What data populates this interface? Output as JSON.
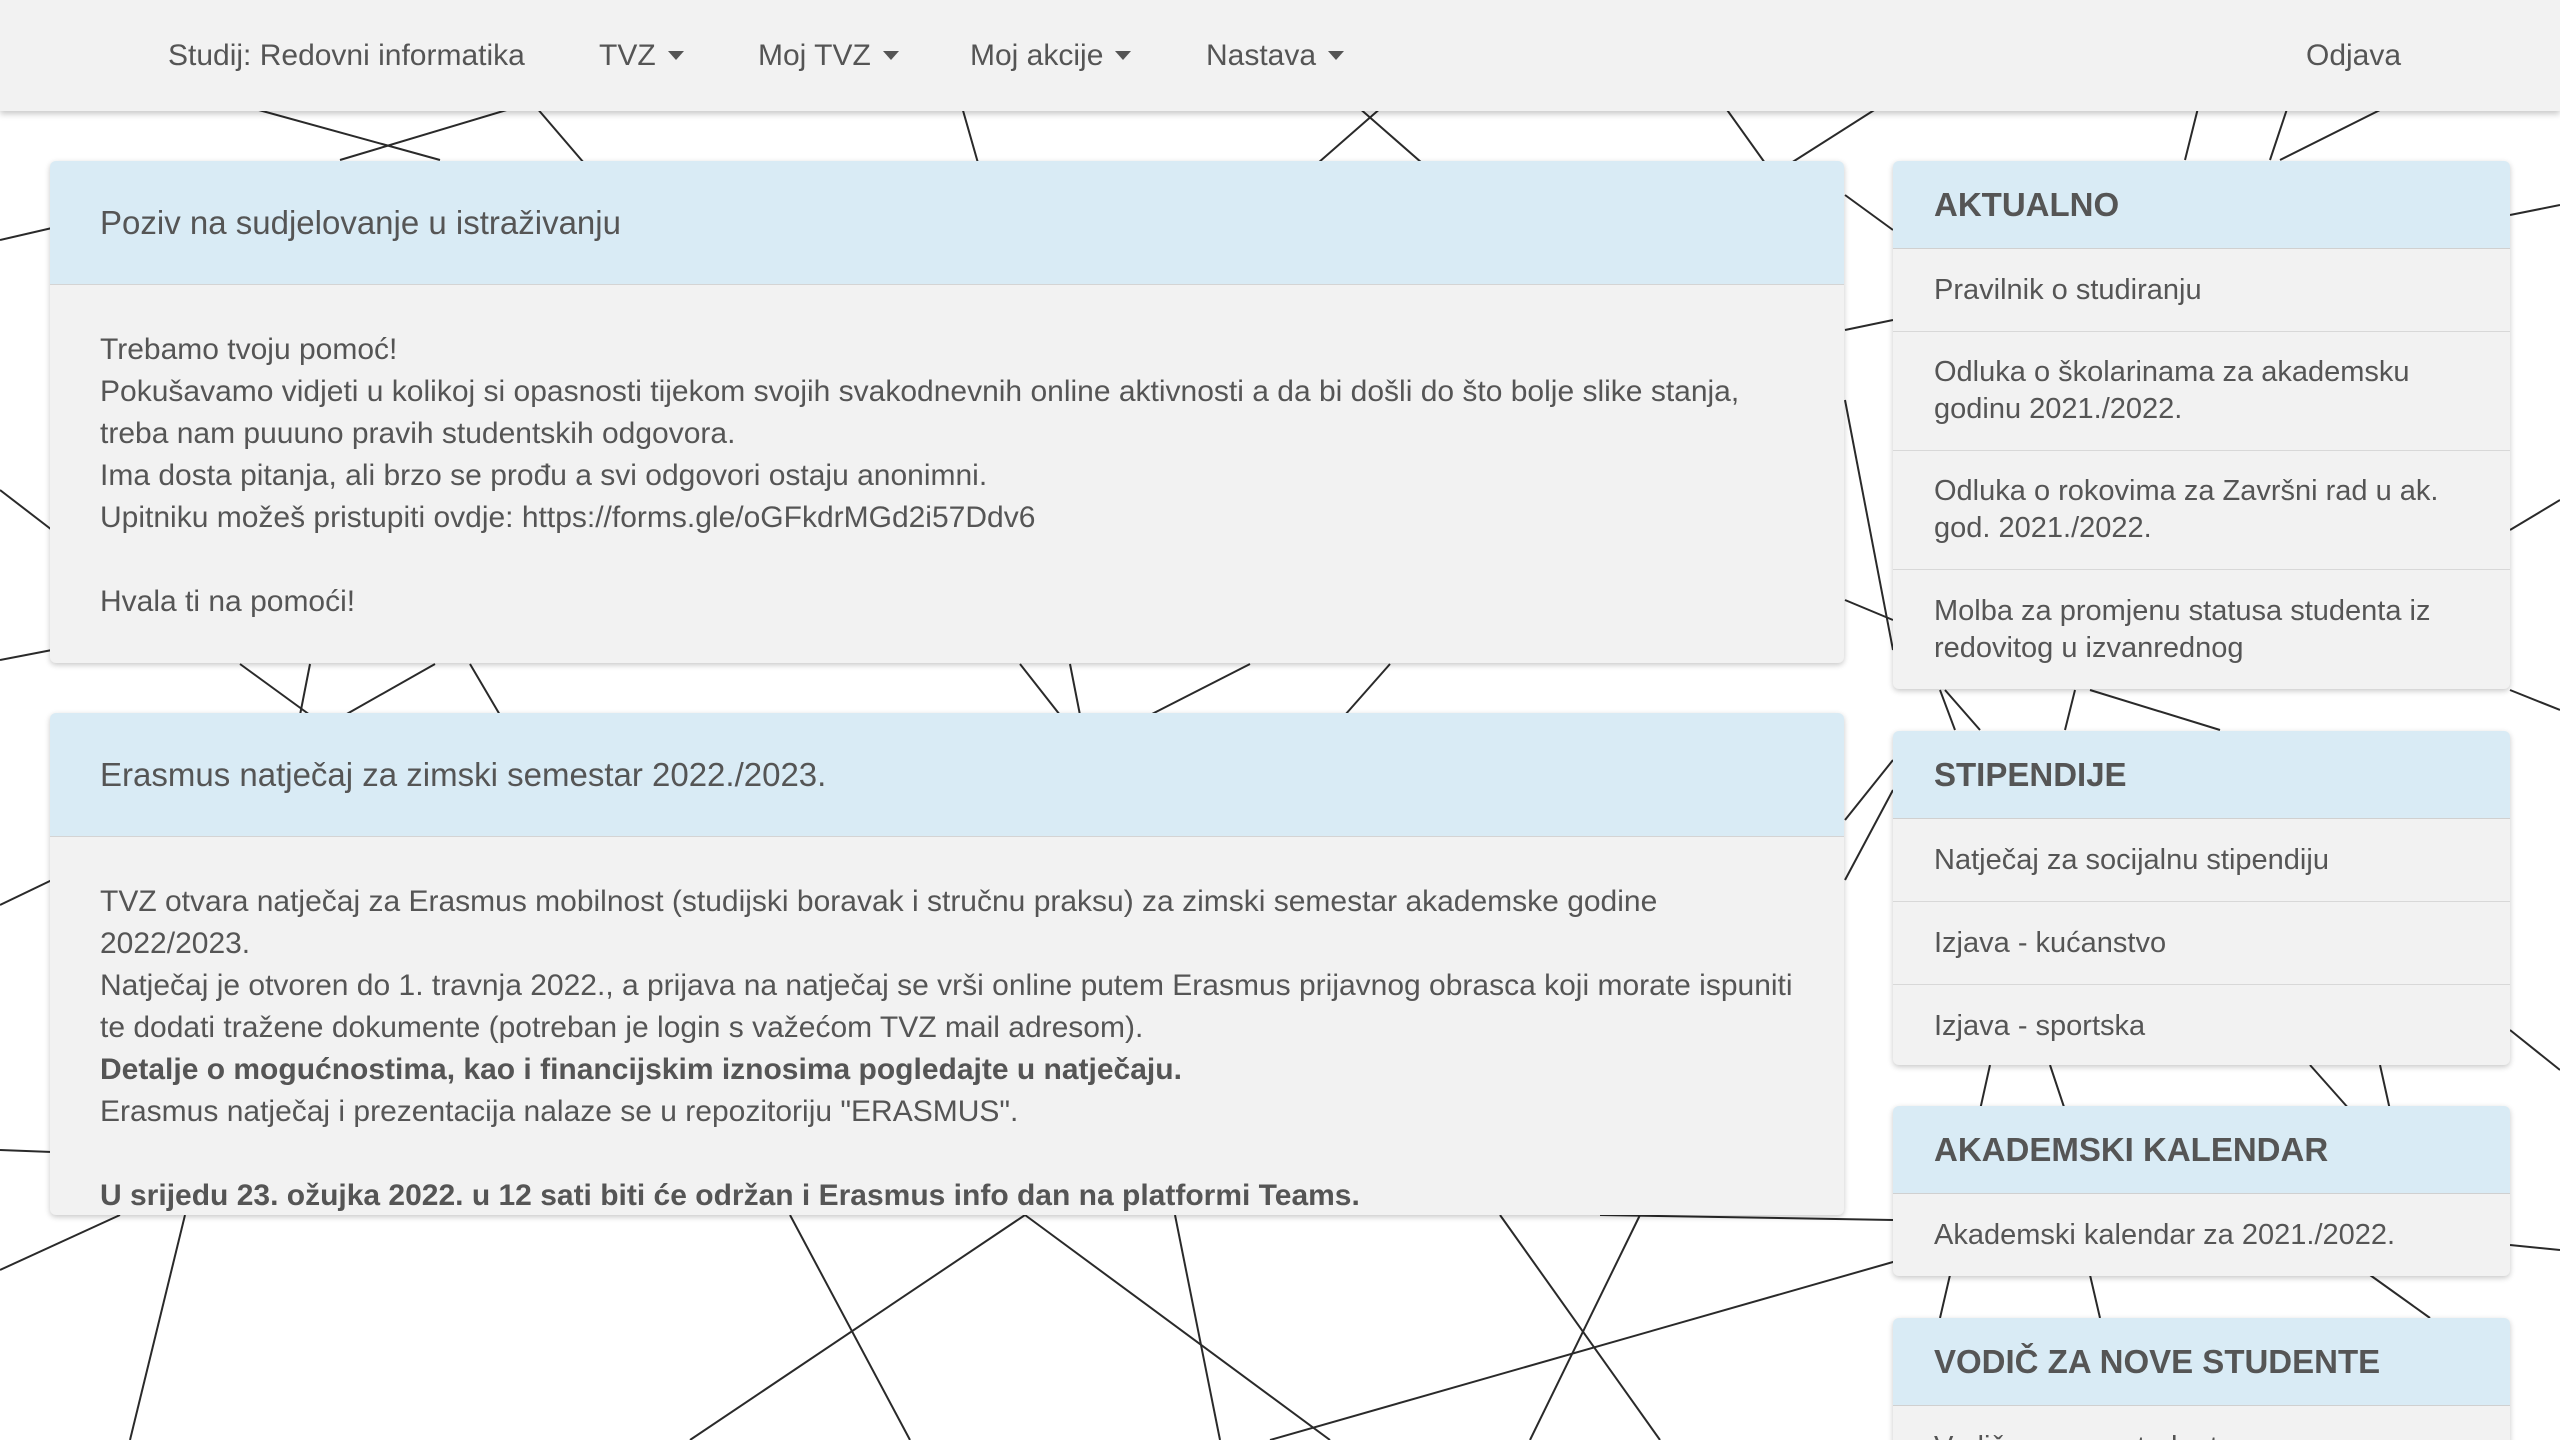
{
  "navbar": {
    "studij": "Studij: Redovni informatika",
    "items": [
      "TVZ",
      "Moj TVZ",
      "Moj akcije",
      "Nastava"
    ],
    "logout": "Odjava"
  },
  "posts": [
    {
      "title": "Poziv na sudjelovanje u istraživanju",
      "lines": [
        "Trebamo tvoju pomoć!",
        "Pokušavamo vidjeti u kolikoj si opasnosti tijekom svojih svakodnevnih online aktivnosti a da bi došli do što bolje slike stanja, treba nam puuuno pravih studentskih odgovora.",
        "Ima dosta pitanja, ali brzo se prođu a svi odgovori ostaju anonimni.",
        "Upitniku možeš pristupiti ovdje: https://forms.gle/oGFkdrMGd2i57Ddv6",
        "Hvala ti na pomoći!"
      ]
    },
    {
      "title": "Erasmus natječaj za zimski semestar 2022./2023.",
      "lines": [
        "TVZ otvara natječaj za Erasmus mobilnost (studijski boravak i stručnu praksu) za zimski semestar akademske godine 2022/2023.",
        "Natječaj je otvoren do 1. travnja 2022., a prijava na natječaj se vrši online putem Erasmus prijavnog obrasca koji morate ispuniti te dodati tražene dokumente (potreban je login s važećom TVZ mail adresom).",
        "Detalje o mogućnostima, kao i financijskim iznosima pogledajte u natječaju.",
        "Erasmus natječaj i prezentacija nalaze se u repozitoriju \"ERASMUS\".",
        "U srijedu 23. ožujka 2022. u 12 sati biti će održan i Erasmus info dan na platformi Teams."
      ]
    }
  ],
  "sidebar": {
    "aktualno": {
      "title": "AKTUALNO",
      "items": [
        "Pravilnik o studiranju",
        "Odluka o školarinama za akademsku godinu 2021./2022.",
        "Odluka o rokovima za Završni rad u ak. god. 2021./2022.",
        "Molba za promjenu statusa studenta iz redovitog u izvanrednog"
      ]
    },
    "stipendije": {
      "title": "STIPENDIJE",
      "items": [
        "Natječaj za socijalnu stipendiju",
        "Izjava - kućanstvo",
        "Izjava - sportska"
      ]
    },
    "kalendar": {
      "title": "AKADEMSKI KALENDAR",
      "items": [
        "Akademski kalendar za 2021./2022."
      ]
    },
    "vodic": {
      "title": "VODIČ ZA NOVE STUDENTE",
      "items": [
        "Vodič za nove studente"
      ]
    }
  },
  "colors": {
    "navbar_bg": "#f2f2f2",
    "header_blue": "#d9ebf5",
    "card_bg": "#f2f2f2",
    "text": "#555555",
    "background_lines": "#222222"
  }
}
